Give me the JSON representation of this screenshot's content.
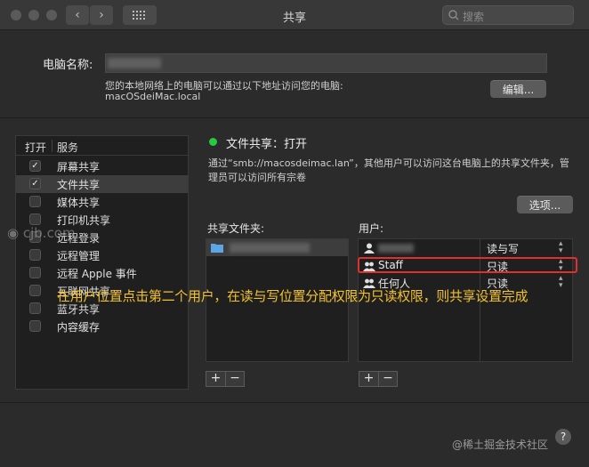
{
  "window": {
    "title": "共享"
  },
  "search": {
    "placeholder": "搜索"
  },
  "computer": {
    "name_label": "电脑名称:",
    "hint": "您的本地网络上的电脑可以通过以下地址访问您的电脑:",
    "address": "macOSdeiMac.local",
    "edit_button": "编辑..."
  },
  "services": {
    "header_on": "打开",
    "header_service": "服务",
    "items": [
      {
        "label": "屏幕共享",
        "checked": true
      },
      {
        "label": "文件共享",
        "checked": true
      },
      {
        "label": "媒体共享",
        "checked": false
      },
      {
        "label": "打印机共享",
        "checked": false
      },
      {
        "label": "远程登录",
        "checked": false
      },
      {
        "label": "远程管理",
        "checked": false
      },
      {
        "label": "远程 Apple 事件",
        "checked": false
      },
      {
        "label": "互联网共享",
        "checked": false
      },
      {
        "label": "蓝牙共享",
        "checked": false
      },
      {
        "label": "内容缓存",
        "checked": false
      }
    ]
  },
  "status": {
    "title": "文件共享：打开",
    "color": "#28c840",
    "description": "通过“smb://macosdeimac.lan”，其他用户可以访问这台电脑上的共享文件夹，管理员可以访问所有宗卷"
  },
  "options_button": "选项...",
  "shared_folders": {
    "label": "共享文件夹:"
  },
  "users": {
    "label": "用户:",
    "rows": [
      {
        "name": "",
        "permission": "读与写"
      },
      {
        "name": "Staff",
        "permission": "只读"
      },
      {
        "name": "任何人",
        "permission": "只读"
      }
    ]
  },
  "plus": "+",
  "minus": "−",
  "annotation": "在用户位置点击第二个用户，在读与写位置分配权限为只读权限，则共享设置完成",
  "watermark_site": "cjb.com",
  "watermark_juejin": "@稀土掘金技术社区",
  "help": "?"
}
